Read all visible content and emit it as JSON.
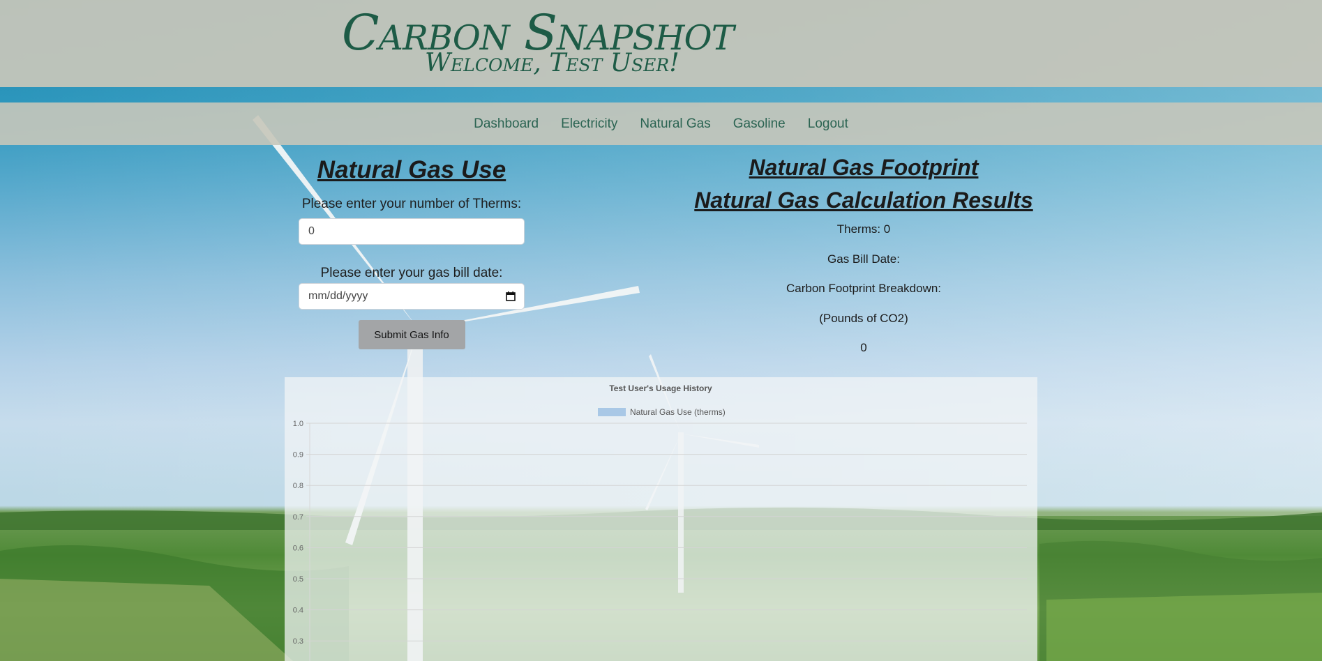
{
  "header": {
    "title": "Carbon Snapshot",
    "welcome": "Welcome, Test User!"
  },
  "nav": {
    "items": [
      {
        "label": "Dashboard"
      },
      {
        "label": "Electricity"
      },
      {
        "label": "Natural Gas"
      },
      {
        "label": "Gasoline"
      },
      {
        "label": "Logout"
      }
    ]
  },
  "form": {
    "title": "Natural Gas Use",
    "therms_label": "Please enter your number of Therms:",
    "therms_value": "0",
    "date_label": "Please enter your gas bill date:",
    "date_placeholder": "mm/dd/yyyy",
    "submit_label": "Submit Gas Info"
  },
  "results": {
    "title": "Natural Gas Footprint",
    "subtitle": "Natural Gas Calculation Results",
    "therms": "Therms: 0",
    "bill_date": "Gas Bill Date:",
    "breakdown": "Carbon Footprint Breakdown:",
    "units": "(Pounds of CO2)",
    "value": "0"
  },
  "chart_data": {
    "type": "bar",
    "title": "Test User's Usage History",
    "series": [
      {
        "name": "Natural Gas Use (therms)",
        "color": "#a9c8e6",
        "values": []
      }
    ],
    "categories": [],
    "ylim": [
      0,
      1.0
    ],
    "yticks": [
      "1.0",
      "0.9",
      "0.8",
      "0.7",
      "0.6",
      "0.5",
      "0.4",
      "0.3"
    ],
    "grid": true,
    "legend": "top"
  }
}
